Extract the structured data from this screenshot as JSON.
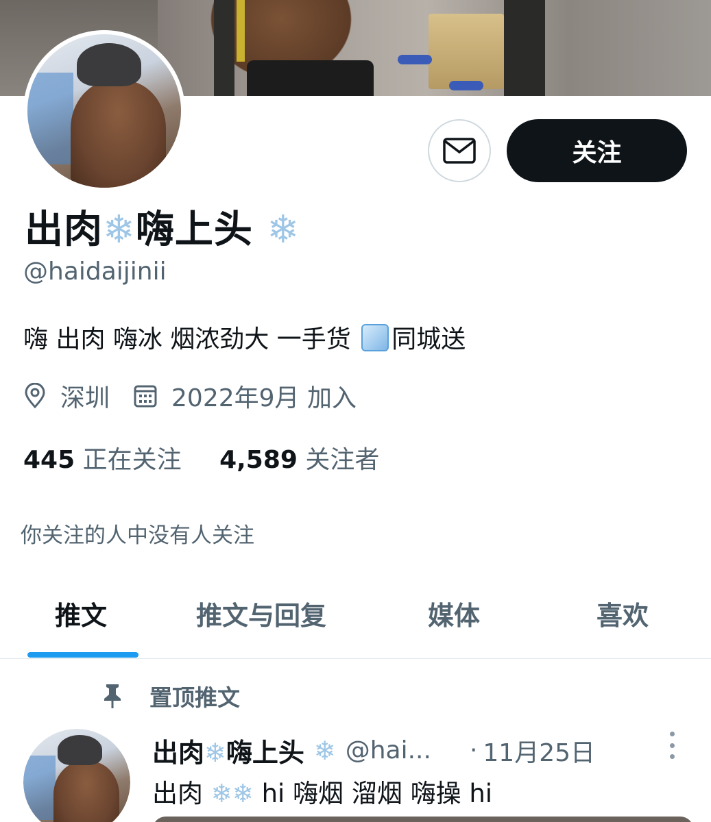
{
  "profile": {
    "name_part1": "出肉",
    "name_part2": "嗨上头",
    "snow_glyph": "❄",
    "handle": "@haidaijinii",
    "bio_part1": "嗨 出肉 嗨冰 烟浓劲大 一手货",
    "bio_part2": "同城送",
    "location": "深圳",
    "joined": "2022年9月 加入",
    "following_count": "445",
    "following_label": "正在关注",
    "followers_count": "4,589",
    "followers_label": "关注者",
    "no_mutual": "你关注的人中没有人关注"
  },
  "actions": {
    "follow_label": "关注"
  },
  "tabs": [
    {
      "label": "推文",
      "active": true
    },
    {
      "label": "推文与回复",
      "active": false
    },
    {
      "label": "媒体",
      "active": false
    },
    {
      "label": "喜欢",
      "active": false
    }
  ],
  "pinned": {
    "label": "置顶推文",
    "tweet": {
      "name_part1": "出肉",
      "name_part2": "嗨上头",
      "handle": "@hai...",
      "date": "11月25日",
      "text_part1": "出肉",
      "text_part2": "hi 嗨烟 溜烟 嗨操 hi"
    }
  },
  "colors": {
    "accent": "#1d9bf0",
    "follow_bg": "#0f1419",
    "secondary_text": "#536471",
    "snow": "#9ec6e6"
  },
  "icons": [
    "mail-icon",
    "location-icon",
    "calendar-icon",
    "pin-icon",
    "snowflake-icon",
    "ice-cube-icon",
    "more-icon"
  ]
}
